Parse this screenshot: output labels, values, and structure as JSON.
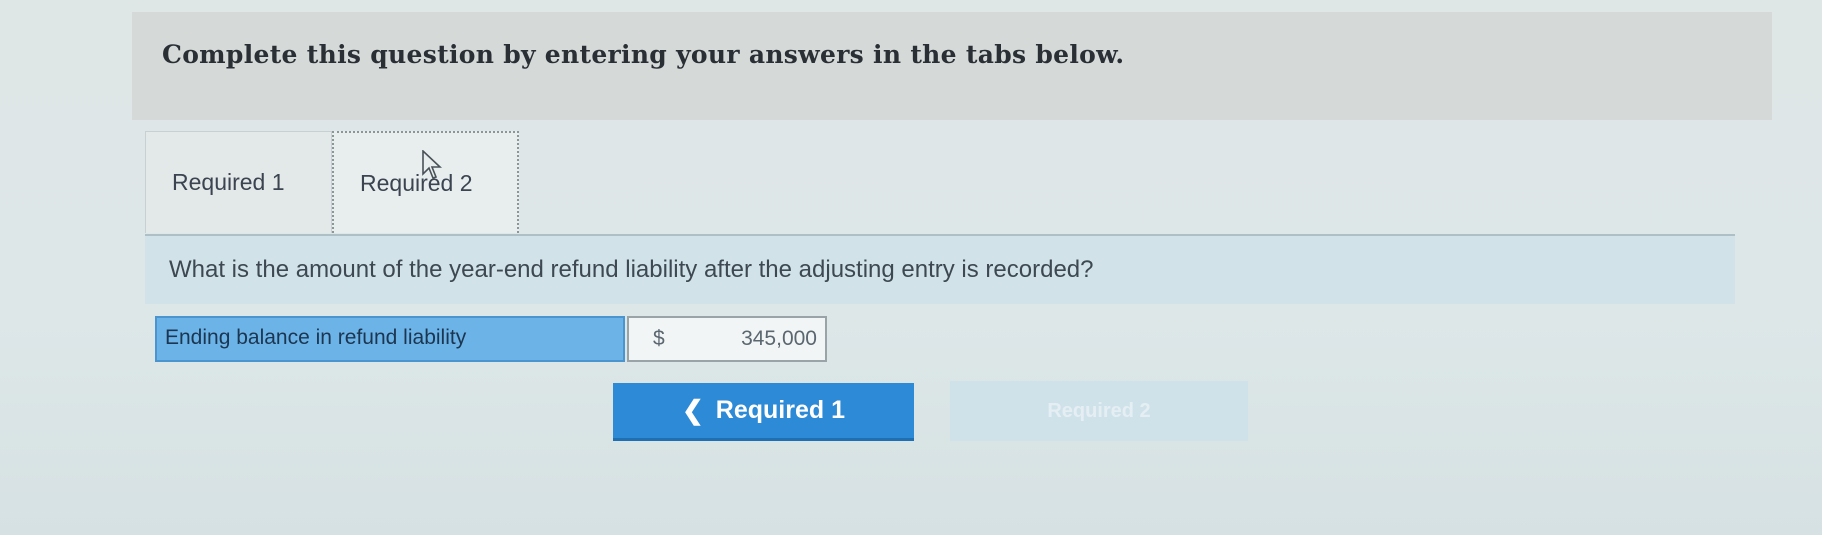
{
  "header": {
    "instruction": "Complete this question by entering your answers in the tabs below."
  },
  "tabs": [
    {
      "label": "Required 1"
    },
    {
      "label": "Required 2"
    }
  ],
  "question": {
    "text": "What is the amount of the year-end refund liability after the adjusting entry is recorded?"
  },
  "answer": {
    "label": "Ending balance in refund liability",
    "currency": "$",
    "value": "345,000"
  },
  "nav": {
    "prev_chevron": "❮",
    "prev_label": "Required 1",
    "next_label": "Required 2"
  },
  "colors": {
    "primary": "#2d8ad6",
    "label_highlight": "#6cb4e8",
    "question_bar": "#d1e3e8"
  }
}
